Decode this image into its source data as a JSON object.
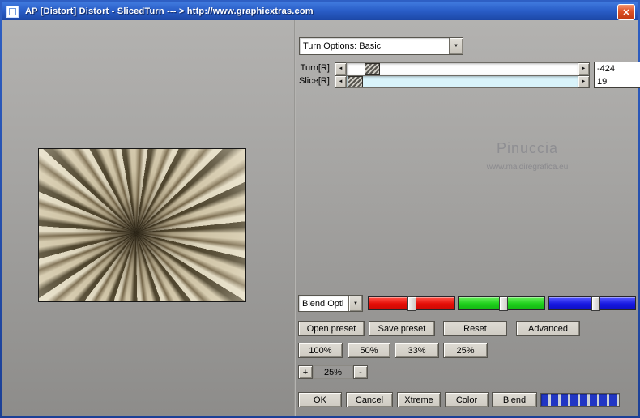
{
  "window": {
    "title": "AP [Distort]  Distort - SlicedTurn   --- > http://www.graphicxtras.com"
  },
  "icons": {
    "close": "✕",
    "dropdown": "▼",
    "arrow_left": "◄",
    "arrow_right": "►"
  },
  "colors": {
    "titlebar_blue": "#2a5ec8",
    "close_button_red": "#d04018",
    "red_slider": "#e40d06",
    "green_slider": "#1ecf1b",
    "blue_slider": "#1718e0",
    "progress_blue": "#2136c4",
    "slice_track_cyan": "#d9f3fa"
  },
  "panel": {
    "turn_options": "Turn Options: Basic",
    "sliders": [
      {
        "label": "Turn[R]:",
        "value": "-424"
      },
      {
        "label": "Slice[R]:",
        "value": "19"
      }
    ],
    "watermark": {
      "line1": "Pinuccia",
      "line2": "www.maidiregrafica.eu"
    },
    "blend_options": "Blend Opti",
    "preset_buttons": [
      "Open preset",
      "Save preset",
      "Reset",
      "Advanced"
    ],
    "zoom_buttons": [
      "100%",
      "50%",
      "33%",
      "25%"
    ],
    "stepper": {
      "plus": "+",
      "value": "25%",
      "minus": "-"
    },
    "action_buttons": [
      "OK",
      "Cancel",
      "Xtreme",
      "Color",
      "Blend"
    ]
  }
}
